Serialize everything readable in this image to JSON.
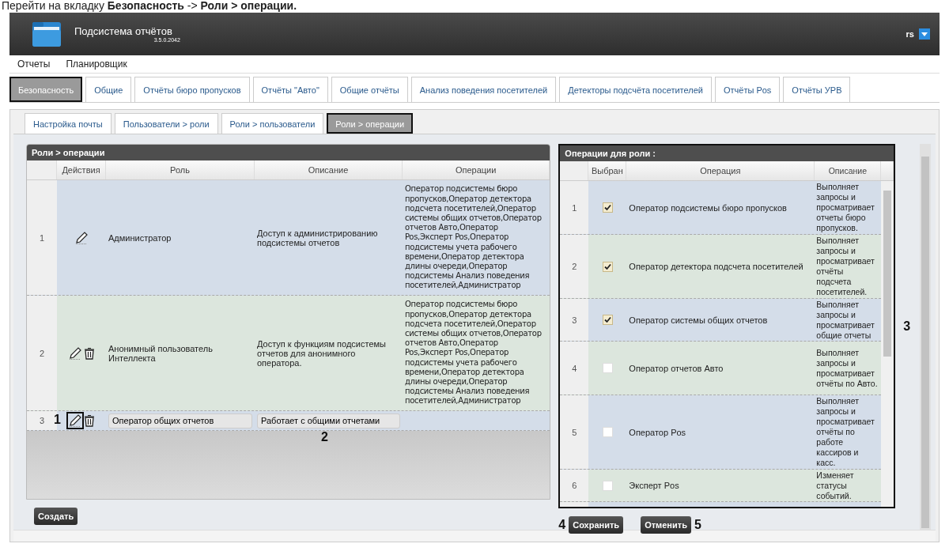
{
  "instruction": "Перейти на вкладку **Безопасность** -> **Роли > операции.**",
  "header": {
    "title": "Подсистема отчётов",
    "version": "3.5.0.2042",
    "user": "rs"
  },
  "menu": [
    "Отчеты",
    "Планировщик"
  ],
  "tabs": [
    {
      "label": "Безопасность",
      "selected": true
    },
    {
      "label": "Общие",
      "selected": false
    },
    {
      "label": "Отчёты бюро пропусков",
      "selected": false
    },
    {
      "label": "Отчёты \"Авто\"",
      "selected": false
    },
    {
      "label": "Общие отчёты",
      "selected": false
    },
    {
      "label": "Анализ поведения посетителей",
      "selected": false
    },
    {
      "label": "Детекторы подсчёта посетителей",
      "selected": false
    },
    {
      "label": "Отчёты Pos",
      "selected": false
    },
    {
      "label": "Отчёты УРВ",
      "selected": false
    }
  ],
  "subtabs": [
    {
      "label": "Настройка почты",
      "selected": false
    },
    {
      "label": "Пользователи > роли",
      "selected": false
    },
    {
      "label": "Роли > пользователи",
      "selected": false
    },
    {
      "label": "Роли > операции",
      "selected": true
    }
  ],
  "roles_table": {
    "title": "Роли > операции",
    "columns": [
      "Действия",
      "Роль",
      "Описание",
      "Операции"
    ],
    "rows": [
      {
        "number": "1",
        "kind": "view",
        "actions": [
          {
            "kind": "edit",
            "highlighted": false
          }
        ],
        "role": "Администратор",
        "description": "Доступ к администрированию подсистемы отчетов",
        "operations": "Оператор подсистемы бюро пропусков,Оператор детектора подсчета посетителей,Оператор системы общих отчетов,Оператор отчетов Авто,Оператор Pos,Эксперт Pos,Оператор подсистемы учета рабочего времени,Оператор детектора длины очереди,Оператор подсистемы Анализ поведения посетителей,Администратор"
      },
      {
        "number": "2",
        "kind": "view",
        "actions": [
          {
            "kind": "edit",
            "highlighted": false
          },
          {
            "kind": "delete",
            "highlighted": false
          }
        ],
        "role": "Анонимный пользователь Интеллекта",
        "description": "Доступ к функциям подсистемы отчетов для анонимного оператора.",
        "operations": "Оператор подсистемы бюро пропусков,Оператор детектора подсчета посетителей,Оператор системы общих отчетов,Оператор отчетов Авто,Оператор Pos,Эксперт Pos,Оператор подсистемы учета рабочего времени,Оператор детектора длины очереди,Оператор подсистемы Анализ поведения посетителей,Администратор"
      },
      {
        "number": "3",
        "kind": "editing",
        "callout": "1",
        "description_callout": "2",
        "actions": [
          {
            "kind": "edit",
            "highlighted": true
          },
          {
            "kind": "delete",
            "highlighted": false
          }
        ],
        "role": "Оператор общих отчетов",
        "description": "Работает с общими отчетами"
      }
    ]
  },
  "create_button": "Создать",
  "operations_table": {
    "title": "Операции для роли :",
    "highlighted": true,
    "callout": "3",
    "columns": [
      "Выбран",
      "Операция",
      "Описание"
    ],
    "rows": [
      {
        "number": "1",
        "checked": true,
        "operation": "Оператор подсистемы бюро пропусков",
        "description": "Выполняет запросы и просматривает отчеты бюро пропусков."
      },
      {
        "number": "2",
        "checked": true,
        "operation": "Оператор детектора подсчета посетителей",
        "description": "Выполняет запросы и просматривает отчёты подсчета посетителей."
      },
      {
        "number": "3",
        "checked": true,
        "operation": "Оператор системы общих отчетов",
        "description": "Выполняет запросы и просматривает общие отчеты"
      },
      {
        "number": "4",
        "checked": false,
        "operation": "Оператор отчетов Авто",
        "description": "Выполняет запросы и просматривает отчёты по Авто."
      },
      {
        "number": "5",
        "checked": false,
        "operation": "Оператор Pos",
        "description": "Выполняет запросы и просматривает отчёты по работе кассиров и касс."
      },
      {
        "number": "6",
        "checked": false,
        "operation": "Эксперт Pos",
        "description": "Изменяет статусы событий."
      }
    ]
  },
  "buttons": [
    {
      "kind": "save",
      "label": "Сохранить",
      "callout": "4"
    },
    {
      "kind": "cancel",
      "label": "Отменить",
      "callout": "5"
    }
  ]
}
